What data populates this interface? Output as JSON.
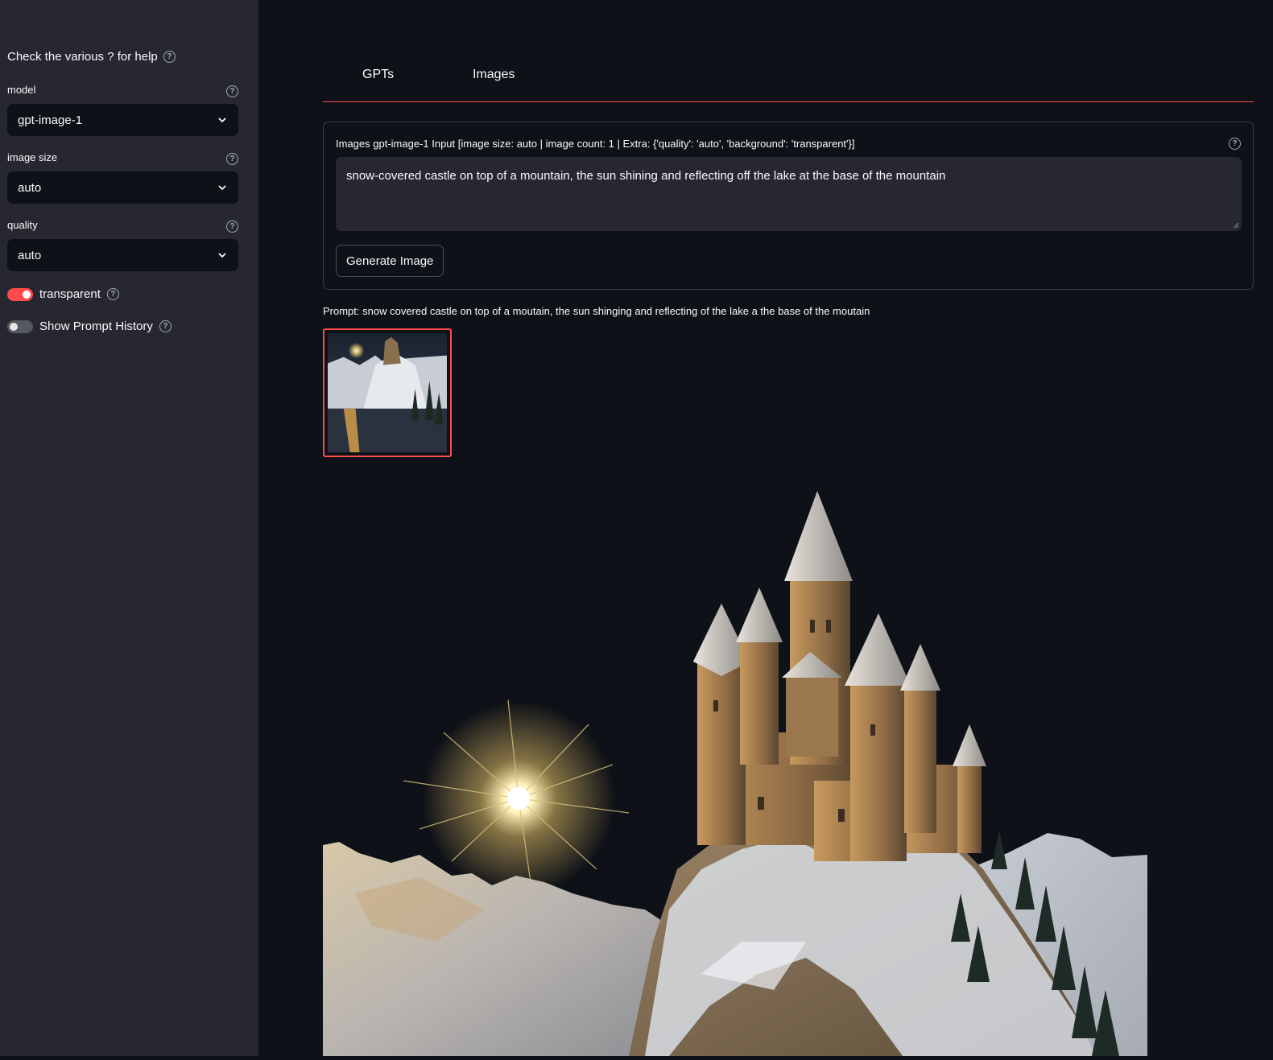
{
  "sidebar": {
    "help_header": "Check the various ? for help",
    "model_label": "model",
    "model_value": "gpt-image-1",
    "image_size_label": "image size",
    "image_size_value": "auto",
    "quality_label": "quality",
    "quality_value": "auto",
    "transparent_label": "transparent",
    "transparent_on": true,
    "history_label": "Show Prompt History",
    "history_on": false
  },
  "tabs": [
    {
      "label": "GPTs"
    },
    {
      "label": "Images"
    }
  ],
  "form": {
    "label": "Images gpt-image-1 Input [image size: auto | image count: 1 | Extra: {'quality': 'auto', 'background': 'transparent'}]",
    "prompt_text": "snow-covered castle on top of a mountain, the sun shining and reflecting off the lake at the base of the mountain",
    "generate_label": "Generate Image"
  },
  "result": {
    "caption": "Prompt: snow covered castle on top of a moutain, the sun shinging and reflecting of the lake a the base of the moutain"
  },
  "colors": {
    "accent": "#ff4b4b",
    "background": "#0e1117",
    "sidebar": "#262730"
  }
}
